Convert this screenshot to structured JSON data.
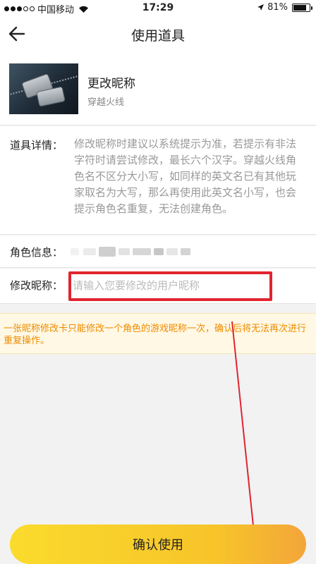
{
  "status_bar": {
    "carrier": "中国移动",
    "time": "17:29",
    "battery": "81%",
    "battery_level": 0.81
  },
  "nav": {
    "title": "使用道具"
  },
  "item": {
    "name": "更改昵称",
    "game": "穿越火线"
  },
  "detail": {
    "label": "道具详情：",
    "text": "修改昵称时建议以系统提示为准，若提示有非法字符时请尝试修改，最长六个汉字。穿越火线角色名不区分大小写，如同样的英文名已有其他玩家取名为大写，那么再使用此英文名小写，也会提示角色名重复，无法创建角色。"
  },
  "role": {
    "label": "角色信息："
  },
  "nickname": {
    "label": "修改昵称：",
    "value": "",
    "placeholder": "请输入您要修改的用户昵称"
  },
  "notice": {
    "text": "一张昵称修改卡只能修改一个角色的游戏昵称一次，确认后将无法再次进行重复操作。"
  },
  "confirm_button": {
    "label": "确认使用"
  },
  "colors": {
    "accent_yellow": "#f9d42b",
    "notice_orange": "#ee8b00",
    "annotation_red": "#e0252f"
  }
}
